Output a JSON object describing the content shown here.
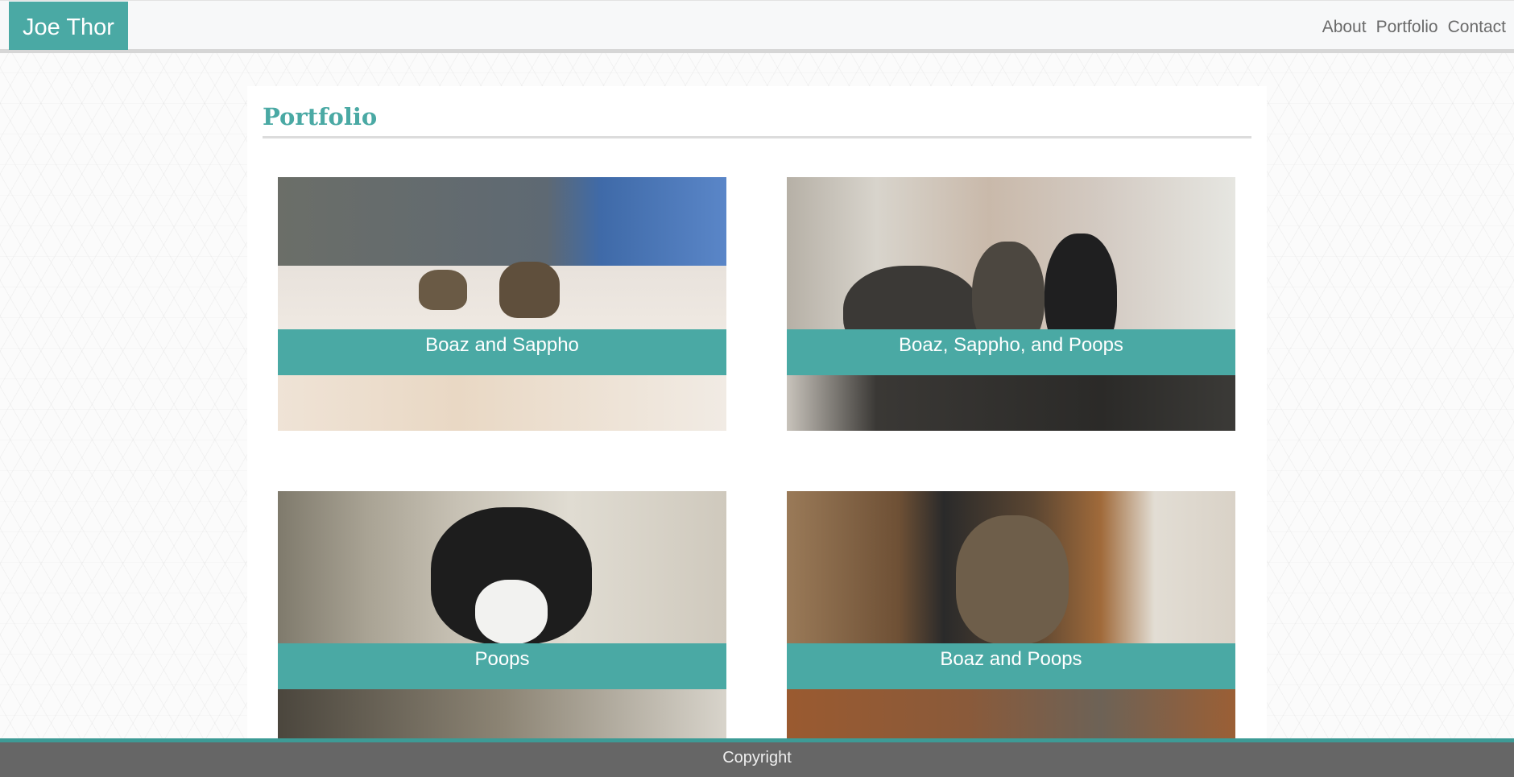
{
  "site": {
    "brand": "Joe Thor"
  },
  "nav": {
    "items": [
      "About",
      "Portfolio",
      "Contact"
    ]
  },
  "page": {
    "title": "Portfolio"
  },
  "portfolio": {
    "items": [
      {
        "caption": "Boaz and Sappho"
      },
      {
        "caption": "Boaz, Sappho, and Poops"
      },
      {
        "caption": "Poops"
      },
      {
        "caption": "Boaz and Poops"
      }
    ]
  },
  "footer": {
    "text": "Copyright"
  },
  "colors": {
    "accent": "#4aa9a4",
    "footer": "#666666",
    "nav_text": "#6a6a6a"
  }
}
